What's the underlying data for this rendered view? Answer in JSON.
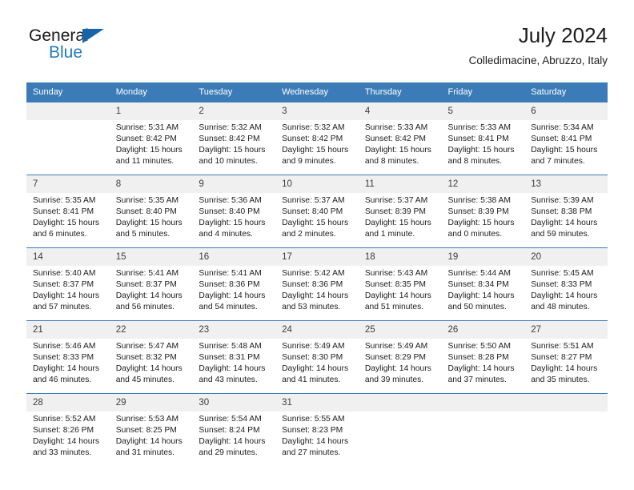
{
  "brand": {
    "name_top": "General",
    "name_bottom": "Blue",
    "accent_color": "#1f7ac4",
    "triangle_color": "#1565a8"
  },
  "header": {
    "title": "July 2024",
    "subtitle": "Colledimacine, Abruzzo, Italy"
  },
  "theme": {
    "header_row_bg": "#3b7cb8",
    "daynum_bg": "#f0f0f0",
    "grid_line": "#3b7cb8",
    "text": "#1c1c1c"
  },
  "weekday_headers": [
    "Sunday",
    "Monday",
    "Tuesday",
    "Wednesday",
    "Thursday",
    "Friday",
    "Saturday"
  ],
  "weeks": [
    [
      {
        "day": "",
        "sunrise": "",
        "sunset": "",
        "daylight_1": "",
        "daylight_2": "",
        "empty": true
      },
      {
        "day": "1",
        "sunrise": "Sunrise: 5:31 AM",
        "sunset": "Sunset: 8:42 PM",
        "daylight_1": "Daylight: 15 hours",
        "daylight_2": "and 11 minutes."
      },
      {
        "day": "2",
        "sunrise": "Sunrise: 5:32 AM",
        "sunset": "Sunset: 8:42 PM",
        "daylight_1": "Daylight: 15 hours",
        "daylight_2": "and 10 minutes."
      },
      {
        "day": "3",
        "sunrise": "Sunrise: 5:32 AM",
        "sunset": "Sunset: 8:42 PM",
        "daylight_1": "Daylight: 15 hours",
        "daylight_2": "and 9 minutes."
      },
      {
        "day": "4",
        "sunrise": "Sunrise: 5:33 AM",
        "sunset": "Sunset: 8:42 PM",
        "daylight_1": "Daylight: 15 hours",
        "daylight_2": "and 8 minutes."
      },
      {
        "day": "5",
        "sunrise": "Sunrise: 5:33 AM",
        "sunset": "Sunset: 8:41 PM",
        "daylight_1": "Daylight: 15 hours",
        "daylight_2": "and 8 minutes."
      },
      {
        "day": "6",
        "sunrise": "Sunrise: 5:34 AM",
        "sunset": "Sunset: 8:41 PM",
        "daylight_1": "Daylight: 15 hours",
        "daylight_2": "and 7 minutes."
      }
    ],
    [
      {
        "day": "7",
        "sunrise": "Sunrise: 5:35 AM",
        "sunset": "Sunset: 8:41 PM",
        "daylight_1": "Daylight: 15 hours",
        "daylight_2": "and 6 minutes."
      },
      {
        "day": "8",
        "sunrise": "Sunrise: 5:35 AM",
        "sunset": "Sunset: 8:40 PM",
        "daylight_1": "Daylight: 15 hours",
        "daylight_2": "and 5 minutes."
      },
      {
        "day": "9",
        "sunrise": "Sunrise: 5:36 AM",
        "sunset": "Sunset: 8:40 PM",
        "daylight_1": "Daylight: 15 hours",
        "daylight_2": "and 4 minutes."
      },
      {
        "day": "10",
        "sunrise": "Sunrise: 5:37 AM",
        "sunset": "Sunset: 8:40 PM",
        "daylight_1": "Daylight: 15 hours",
        "daylight_2": "and 2 minutes."
      },
      {
        "day": "11",
        "sunrise": "Sunrise: 5:37 AM",
        "sunset": "Sunset: 8:39 PM",
        "daylight_1": "Daylight: 15 hours",
        "daylight_2": "and 1 minute."
      },
      {
        "day": "12",
        "sunrise": "Sunrise: 5:38 AM",
        "sunset": "Sunset: 8:39 PM",
        "daylight_1": "Daylight: 15 hours",
        "daylight_2": "and 0 minutes."
      },
      {
        "day": "13",
        "sunrise": "Sunrise: 5:39 AM",
        "sunset": "Sunset: 8:38 PM",
        "daylight_1": "Daylight: 14 hours",
        "daylight_2": "and 59 minutes."
      }
    ],
    [
      {
        "day": "14",
        "sunrise": "Sunrise: 5:40 AM",
        "sunset": "Sunset: 8:37 PM",
        "daylight_1": "Daylight: 14 hours",
        "daylight_2": "and 57 minutes."
      },
      {
        "day": "15",
        "sunrise": "Sunrise: 5:41 AM",
        "sunset": "Sunset: 8:37 PM",
        "daylight_1": "Daylight: 14 hours",
        "daylight_2": "and 56 minutes."
      },
      {
        "day": "16",
        "sunrise": "Sunrise: 5:41 AM",
        "sunset": "Sunset: 8:36 PM",
        "daylight_1": "Daylight: 14 hours",
        "daylight_2": "and 54 minutes."
      },
      {
        "day": "17",
        "sunrise": "Sunrise: 5:42 AM",
        "sunset": "Sunset: 8:36 PM",
        "daylight_1": "Daylight: 14 hours",
        "daylight_2": "and 53 minutes."
      },
      {
        "day": "18",
        "sunrise": "Sunrise: 5:43 AM",
        "sunset": "Sunset: 8:35 PM",
        "daylight_1": "Daylight: 14 hours",
        "daylight_2": "and 51 minutes."
      },
      {
        "day": "19",
        "sunrise": "Sunrise: 5:44 AM",
        "sunset": "Sunset: 8:34 PM",
        "daylight_1": "Daylight: 14 hours",
        "daylight_2": "and 50 minutes."
      },
      {
        "day": "20",
        "sunrise": "Sunrise: 5:45 AM",
        "sunset": "Sunset: 8:33 PM",
        "daylight_1": "Daylight: 14 hours",
        "daylight_2": "and 48 minutes."
      }
    ],
    [
      {
        "day": "21",
        "sunrise": "Sunrise: 5:46 AM",
        "sunset": "Sunset: 8:33 PM",
        "daylight_1": "Daylight: 14 hours",
        "daylight_2": "and 46 minutes."
      },
      {
        "day": "22",
        "sunrise": "Sunrise: 5:47 AM",
        "sunset": "Sunset: 8:32 PM",
        "daylight_1": "Daylight: 14 hours",
        "daylight_2": "and 45 minutes."
      },
      {
        "day": "23",
        "sunrise": "Sunrise: 5:48 AM",
        "sunset": "Sunset: 8:31 PM",
        "daylight_1": "Daylight: 14 hours",
        "daylight_2": "and 43 minutes."
      },
      {
        "day": "24",
        "sunrise": "Sunrise: 5:49 AM",
        "sunset": "Sunset: 8:30 PM",
        "daylight_1": "Daylight: 14 hours",
        "daylight_2": "and 41 minutes."
      },
      {
        "day": "25",
        "sunrise": "Sunrise: 5:49 AM",
        "sunset": "Sunset: 8:29 PM",
        "daylight_1": "Daylight: 14 hours",
        "daylight_2": "and 39 minutes."
      },
      {
        "day": "26",
        "sunrise": "Sunrise: 5:50 AM",
        "sunset": "Sunset: 8:28 PM",
        "daylight_1": "Daylight: 14 hours",
        "daylight_2": "and 37 minutes."
      },
      {
        "day": "27",
        "sunrise": "Sunrise: 5:51 AM",
        "sunset": "Sunset: 8:27 PM",
        "daylight_1": "Daylight: 14 hours",
        "daylight_2": "and 35 minutes."
      }
    ],
    [
      {
        "day": "28",
        "sunrise": "Sunrise: 5:52 AM",
        "sunset": "Sunset: 8:26 PM",
        "daylight_1": "Daylight: 14 hours",
        "daylight_2": "and 33 minutes."
      },
      {
        "day": "29",
        "sunrise": "Sunrise: 5:53 AM",
        "sunset": "Sunset: 8:25 PM",
        "daylight_1": "Daylight: 14 hours",
        "daylight_2": "and 31 minutes."
      },
      {
        "day": "30",
        "sunrise": "Sunrise: 5:54 AM",
        "sunset": "Sunset: 8:24 PM",
        "daylight_1": "Daylight: 14 hours",
        "daylight_2": "and 29 minutes."
      },
      {
        "day": "31",
        "sunrise": "Sunrise: 5:55 AM",
        "sunset": "Sunset: 8:23 PM",
        "daylight_1": "Daylight: 14 hours",
        "daylight_2": "and 27 minutes."
      },
      {
        "day": "",
        "sunrise": "",
        "sunset": "",
        "daylight_1": "",
        "daylight_2": "",
        "empty": true
      },
      {
        "day": "",
        "sunrise": "",
        "sunset": "",
        "daylight_1": "",
        "daylight_2": "",
        "empty": true
      },
      {
        "day": "",
        "sunrise": "",
        "sunset": "",
        "daylight_1": "",
        "daylight_2": "",
        "empty": true
      }
    ]
  ]
}
